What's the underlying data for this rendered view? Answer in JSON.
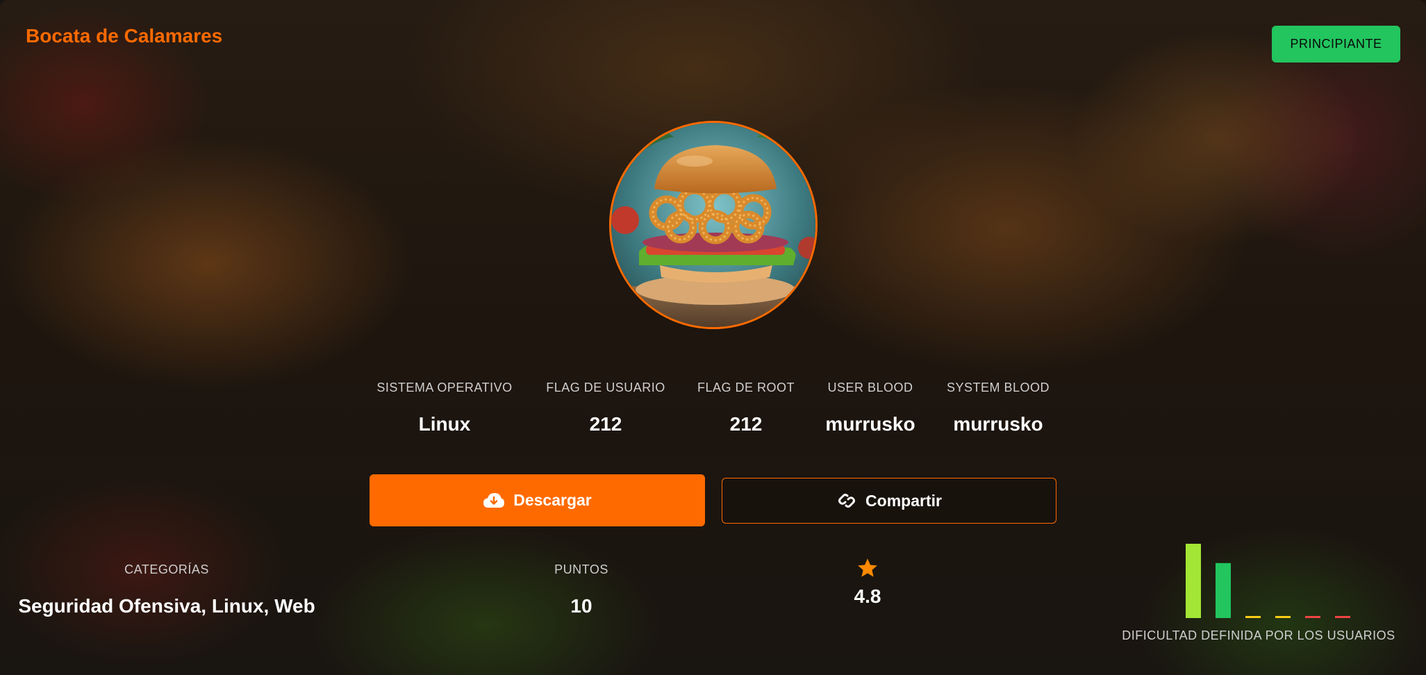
{
  "header": {
    "title": "Bocata de Calamares",
    "level_badge": "PRINCIPIANTE"
  },
  "stats": [
    {
      "label": "SISTEMA OPERATIVO",
      "value": "Linux"
    },
    {
      "label": "FLAG DE USUARIO",
      "value": "212"
    },
    {
      "label": "FLAG DE ROOT",
      "value": "212"
    },
    {
      "label": "USER BLOOD",
      "value": "murrusko"
    },
    {
      "label": "SYSTEM BLOOD",
      "value": "murrusko"
    }
  ],
  "actions": {
    "download_label": "Descargar",
    "share_label": "Compartir"
  },
  "footer": {
    "categories_label": "CATEGORÍAS",
    "categories_value": "Seguridad Ofensiva, Linux, Web",
    "points_label": "PUNTOS",
    "points_value": "10",
    "rating_value": "4.8",
    "difficulty_label": "DIFICULTAD DEFINIDA POR LOS USUARIOS"
  },
  "difficulty_votes": [
    {
      "level": 1,
      "share": 1.0,
      "color": "#a3e635"
    },
    {
      "level": 2,
      "share": 0.74,
      "color": "#22c55e"
    },
    {
      "level": 3,
      "share": 0.0,
      "color": "#facc15"
    },
    {
      "level": 4,
      "share": 0.0,
      "color": "#facc15"
    },
    {
      "level": 5,
      "share": 0.0,
      "color": "#ef4444"
    },
    {
      "level": 6,
      "share": 0.0,
      "color": "#ef4444"
    }
  ],
  "colors": {
    "accent": "#ff6a00",
    "badge": "#22c55e",
    "star": "#ff8a00"
  },
  "icons": {
    "download": "cloud-download-icon",
    "share": "link-icon",
    "rating": "star-icon"
  }
}
